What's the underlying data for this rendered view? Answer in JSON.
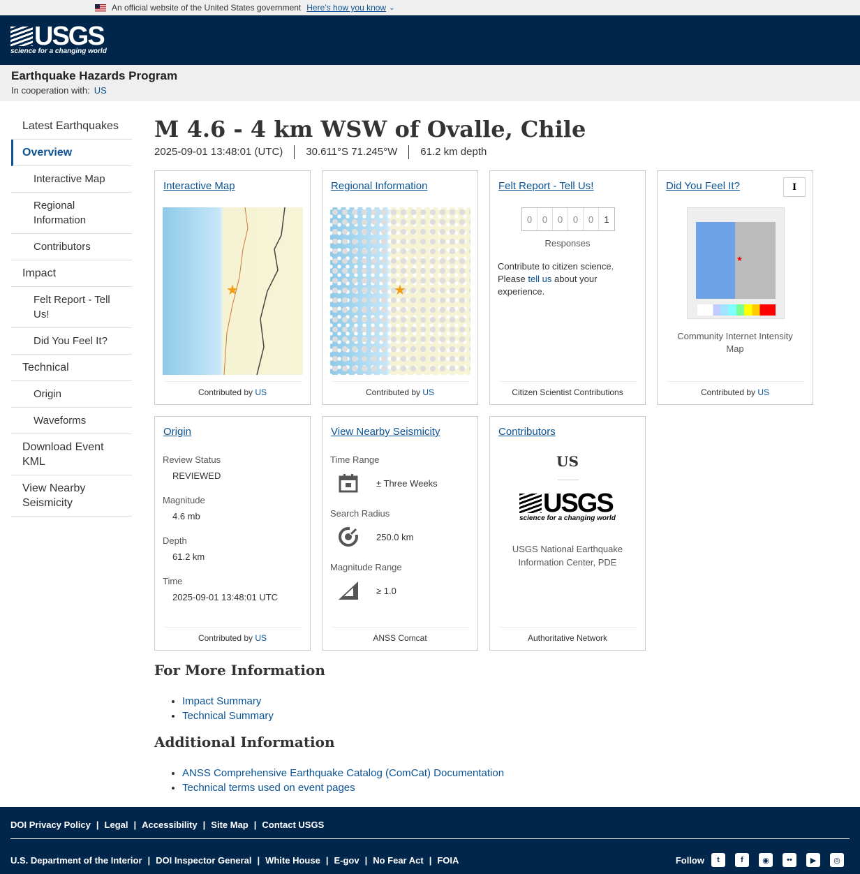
{
  "gov_banner": {
    "text": "An official website of the United States government",
    "link": "Here’s how you know"
  },
  "header": {
    "logo_text": "USGS",
    "logo_tagline": "science for a changing world"
  },
  "program": {
    "title": "Earthquake Hazards Program",
    "coop_label": "In cooperation with:",
    "coop_link": "US"
  },
  "sidebar": {
    "items": [
      {
        "label": "Latest Earthquakes"
      },
      {
        "label": "Overview"
      },
      {
        "label": "Interactive Map"
      },
      {
        "label": "Regional Information"
      },
      {
        "label": "Contributors"
      },
      {
        "label": "Impact"
      },
      {
        "label": "Felt Report - Tell Us!"
      },
      {
        "label": "Did You Feel It?"
      },
      {
        "label": "Technical"
      },
      {
        "label": "Origin"
      },
      {
        "label": "Waveforms"
      },
      {
        "label": "Download Event KML"
      },
      {
        "label": "View Nearby Seismicity"
      }
    ]
  },
  "event": {
    "title": "M 4.6 - 4 km WSW of Ovalle, Chile",
    "time": "2025-09-01 13:48:01 (UTC)",
    "location": "30.611°S 71.245°W",
    "depth": "61.2 km depth"
  },
  "cards": {
    "interactive_map": {
      "title": "Interactive Map",
      "foot_prefix": "Contributed by",
      "foot_link": "US"
    },
    "regional": {
      "title": "Regional Information",
      "foot_prefix": "Contributed by",
      "foot_link": "US"
    },
    "felt": {
      "title": "Felt Report - Tell Us!",
      "counter": [
        "0",
        "0",
        "0",
        "0",
        "0",
        "1"
      ],
      "responses": "Responses",
      "text1": "Contribute to citizen science.",
      "text2a": "Please",
      "text2link": "tell us",
      "text2b": "about your experience.",
      "foot": "Citizen Scientist Contributions"
    },
    "dyfi": {
      "title": "Did You Feel It?",
      "button": "I",
      "caption": "Community Internet Intensity Map",
      "foot_prefix": "Contributed by",
      "foot_link": "US"
    },
    "origin": {
      "title": "Origin",
      "review_label": "Review Status",
      "review_val": "REVIEWED",
      "mag_label": "Magnitude",
      "mag_val": "4.6 mb",
      "depth_label": "Depth",
      "depth_val": "61.2 km",
      "time_label": "Time",
      "time_val": "2025-09-01 13:48:01 UTC",
      "foot_prefix": "Contributed by",
      "foot_link": "US"
    },
    "nearby": {
      "title": "View Nearby Seismicity",
      "time_label": "Time Range",
      "time_val": "± Three Weeks",
      "radius_label": "Search Radius",
      "radius_val": "250.0 km",
      "mag_label": "Magnitude Range",
      "mag_val": "≥ 1.0",
      "foot": "ANSS Comcat"
    },
    "contributors": {
      "title": "Contributors",
      "code": "US",
      "logo_text": "USGS",
      "logo_tagline": "science for a changing world",
      "name": "USGS National Earthquake Information Center, PDE",
      "foot": "Authoritative Network"
    }
  },
  "more_info": {
    "heading": "For More Information",
    "links": [
      "Impact Summary",
      "Technical Summary"
    ]
  },
  "additional": {
    "heading": "Additional Information",
    "links": [
      "ANSS Comprehensive Earthquake Catalog (ComCat) Documentation",
      "Technical terms used on event pages"
    ]
  },
  "footer": {
    "row1": [
      "DOI Privacy Policy",
      "Legal",
      "Accessibility",
      "Site Map",
      "Contact USGS"
    ],
    "row2": [
      "U.S. Department of the Interior",
      "DOI Inspector General",
      "White House",
      "E-gov",
      "No Fear Act",
      "FOIA"
    ],
    "follow": "Follow",
    "social_icons": [
      "twitter-icon",
      "facebook-icon",
      "github-icon",
      "flickr-icon",
      "youtube-icon",
      "instagram-icon"
    ]
  }
}
